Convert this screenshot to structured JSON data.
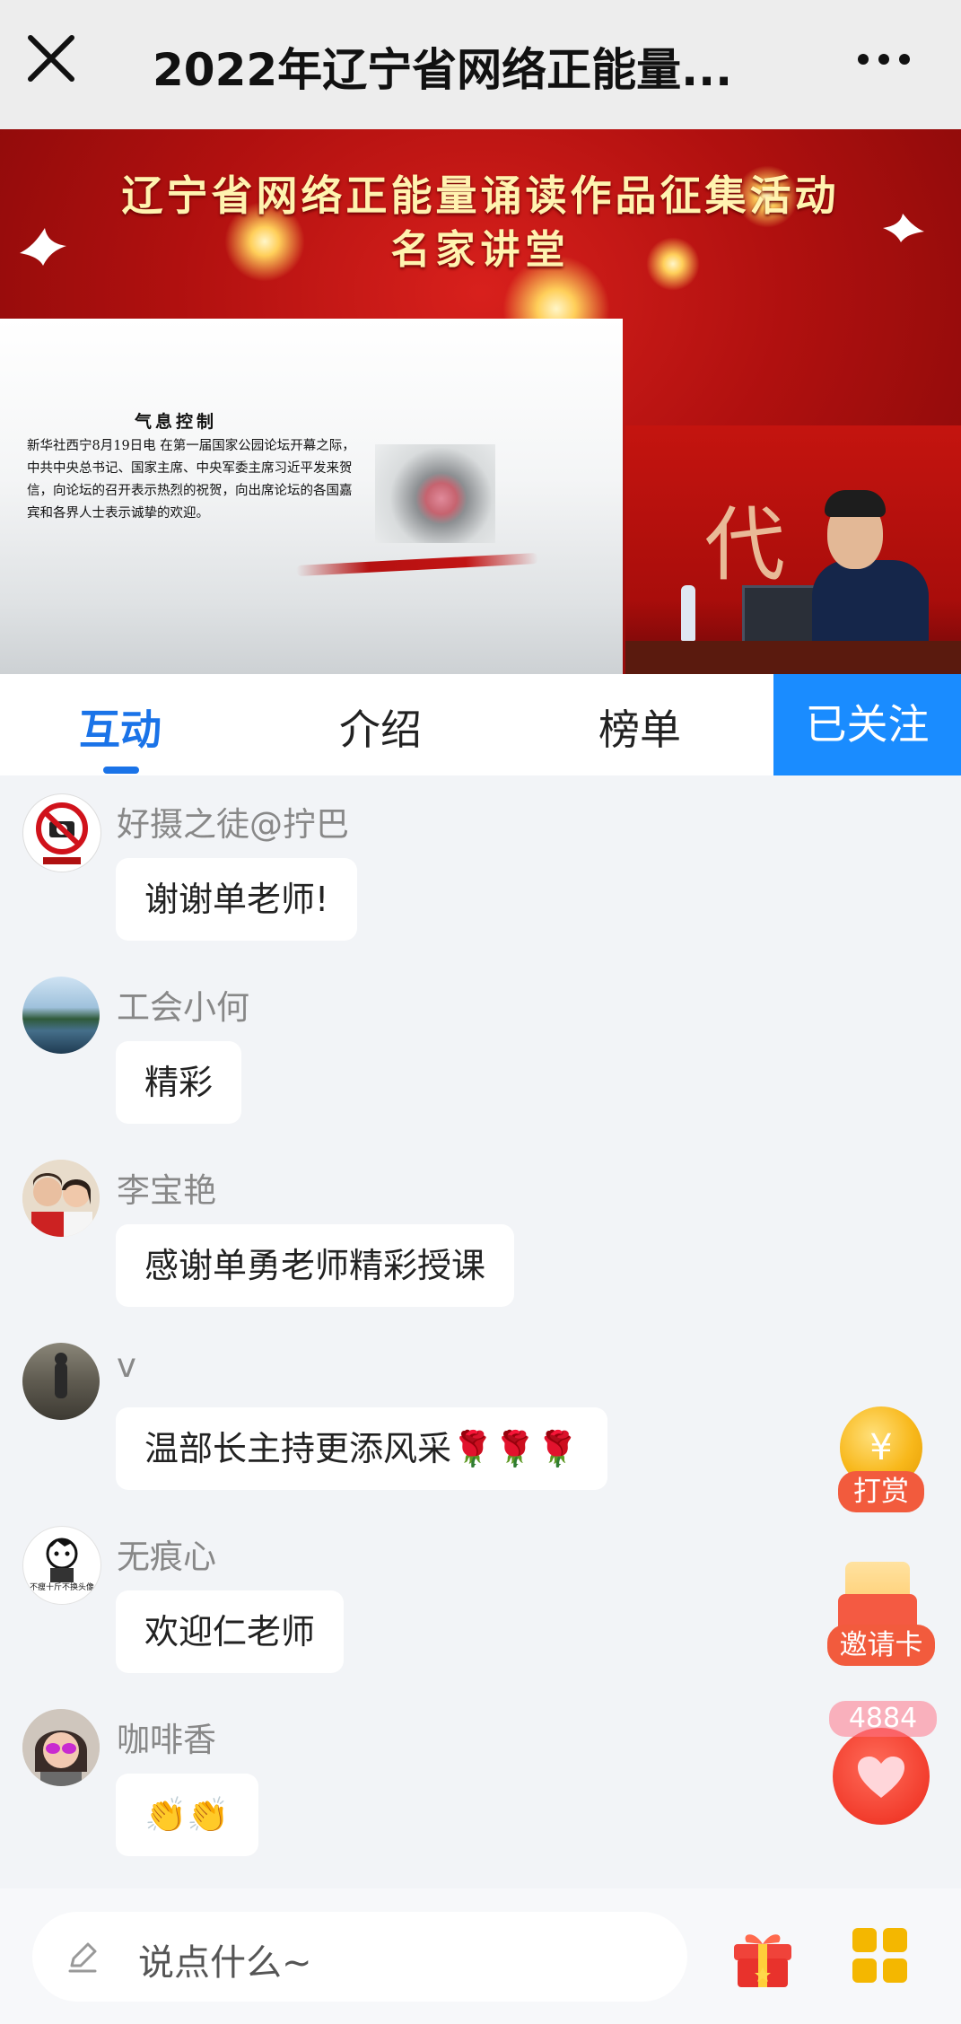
{
  "header": {
    "title": "2022年辽宁省网络正能量..."
  },
  "banner": {
    "title_line1": "辽宁省网络正能量诵读作品征集活动",
    "title_line2": "名家讲堂",
    "slide_heading": "气息控制",
    "slide_text": "新华社西宁8月19日电 在第一届国家公园论坛开幕之际，中共中央总书记、国家主席、中央军委主席习近平发来贺信，向论坛的召开表示热烈的祝贺，向出席论坛的各国嘉宾和各界人士表示诚挚的欢迎。",
    "video_char": "代"
  },
  "tabs": {
    "items": [
      "互动",
      "介绍",
      "榜单"
    ],
    "active": "互动",
    "follow_label": "已关注"
  },
  "chat": {
    "messages": [
      {
        "user": "好摄之徒@拧巴",
        "text": "谢谢单老师!",
        "avatar": "no-camera-icon"
      },
      {
        "user": "工会小何",
        "text": "精彩",
        "avatar": "lake-photo"
      },
      {
        "user": "李宝艳",
        "text": "感谢单勇老师精彩授课",
        "avatar": "two-people-photo"
      },
      {
        "user": "v",
        "text": "温部长主持更添风采🌹🌹🌹",
        "avatar": "corridor-photo"
      },
      {
        "user": "无痕心",
        "text": "欢迎仁老师",
        "avatar": "cartoon-man",
        "avatar_caption": "不瘦十斤不换头像"
      },
      {
        "user": "咖啡香",
        "text": "👏👏",
        "avatar": "sunglasses-woman"
      }
    ]
  },
  "floating": {
    "reward_label": "打赏",
    "reward_symbol": "¥",
    "invite_label": "邀请卡",
    "like_count": "4884",
    "like_icon": "heart-icon"
  },
  "input": {
    "placeholder": "说点什么~"
  },
  "colors": {
    "accent": "#1a73e8",
    "follow_bg": "#1a8cff",
    "banner_red": "#b0100f",
    "reward_gold": "#f8b81b",
    "pill_red": "#f25b3d"
  }
}
